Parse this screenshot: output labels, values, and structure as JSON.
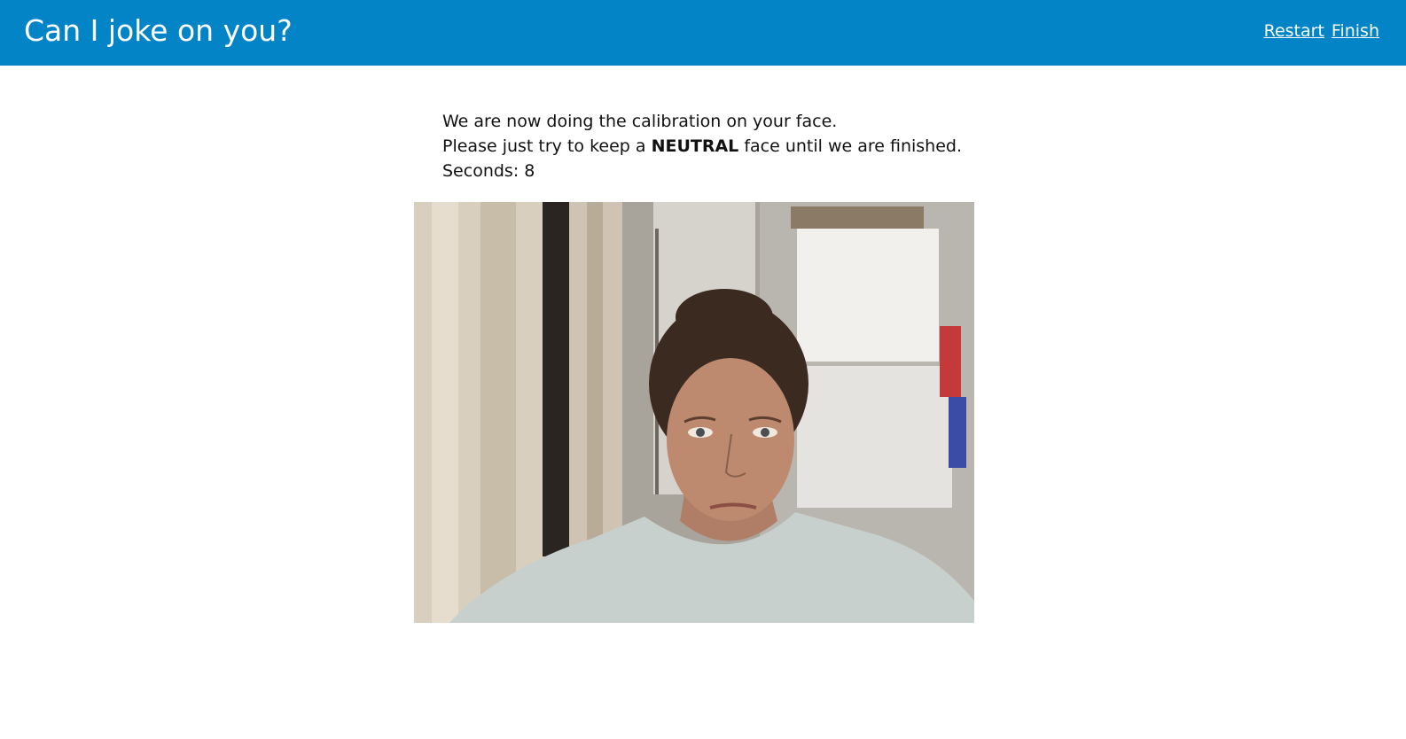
{
  "header": {
    "title": "Can I joke on you?",
    "nav": {
      "restart_label": "Restart",
      "finish_label": "Finish"
    },
    "background_color": "#0284c7"
  },
  "instructions": {
    "line1": "We are now doing the calibration on your face.",
    "line2_prefix": "Please just try to keep a ",
    "line2_emphasis": "NEUTRAL",
    "line2_suffix": " face until we are finished.",
    "seconds_label": "Seconds: ",
    "seconds_value": "8"
  },
  "webcam": {
    "icon": "webcam-feed"
  }
}
